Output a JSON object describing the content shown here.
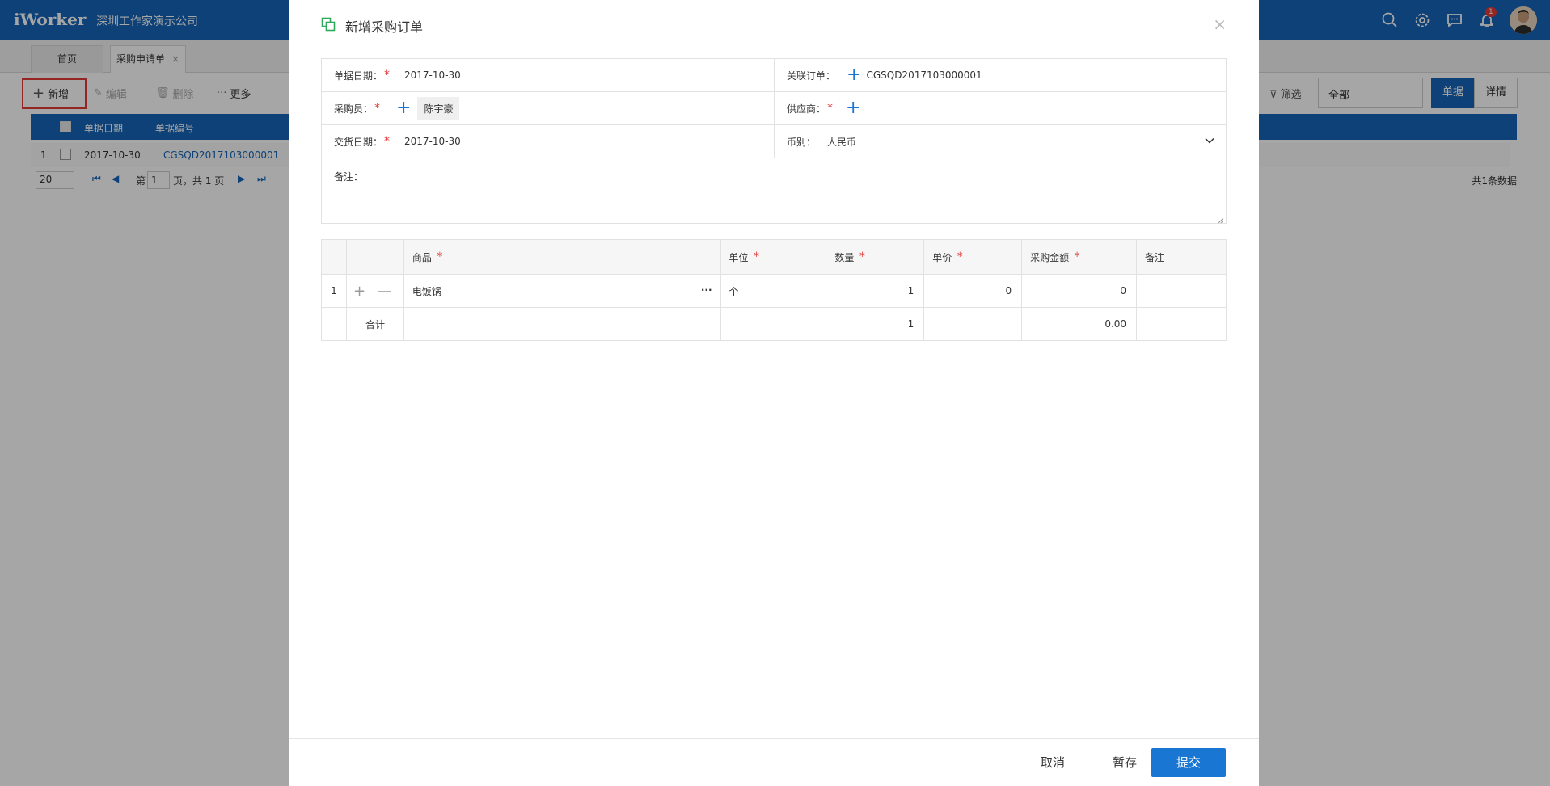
{
  "app": {
    "brand": "iWorker",
    "company": "深圳工作家演示公司",
    "notify_count": "1"
  },
  "tabs": [
    {
      "label": "首页"
    },
    {
      "label": "采购申请单",
      "close": "×"
    }
  ],
  "toolbar": {
    "add": "新增",
    "edit": "编辑",
    "delete": "删除",
    "more": "更多",
    "filter": "筛选",
    "filter_value": "全部",
    "view_doc": "单据",
    "view_detail": "详情"
  },
  "grid": {
    "columns": [
      "单据日期",
      "单据编号"
    ],
    "rows": [
      {
        "index": "1",
        "date": "2017-10-30",
        "code": "CGSQD2017103000001"
      }
    ],
    "pager": {
      "page_size": "20",
      "page_prefix": "第",
      "page_value": "1",
      "page_suffix": "页，共 1 页",
      "total": "共1条数据"
    }
  },
  "modal": {
    "title": "新增采购订单",
    "close": "×",
    "form": {
      "doc_date_label": "单据日期：",
      "doc_date_value": "2017-10-30",
      "linked_order_label": "关联订单：",
      "linked_order_value": "CGSQD2017103000001",
      "buyer_label": "采购员：",
      "buyer_value": "陈宇豪",
      "supplier_label": "供应商：",
      "delivery_date_label": "交货日期：",
      "delivery_date_value": "2017-10-30",
      "currency_label": "币别：",
      "currency_value": "人民币",
      "remark_label": "备注："
    },
    "items": {
      "columns": [
        "商品",
        "单位",
        "数量",
        "单价",
        "采购金额",
        "备注"
      ],
      "rows": [
        {
          "index": "1",
          "product": "电饭锅",
          "more": "···",
          "unit": "个",
          "qty": "1",
          "price": "0",
          "amount": "0",
          "note": ""
        }
      ],
      "total": {
        "label": "合计",
        "qty": "1",
        "amount": "0.00"
      }
    },
    "footer": {
      "cancel": "取消",
      "save_draft": "暂存",
      "submit": "提交"
    }
  },
  "colors": {
    "brand_blue": "#1565b8",
    "primary_button": "#1976d2",
    "required": "#e53935",
    "highlight": "#e53935"
  }
}
